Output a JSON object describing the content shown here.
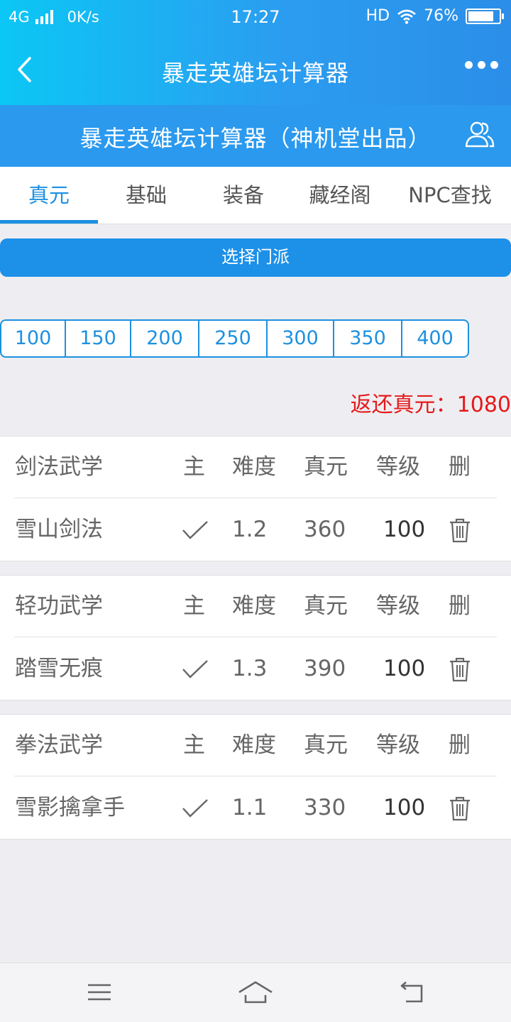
{
  "status_bar": {
    "network": "4G",
    "speed": "0K/s",
    "time": "17:27",
    "hd": "HD",
    "battery": "76%",
    "battery_level": 0.76
  },
  "navbar": {
    "title": "暴走英雄坛计算器"
  },
  "subheader": {
    "title": "暴走英雄坛计算器（神机堂出品）"
  },
  "tabs": [
    "真元",
    "基础",
    "装备",
    "藏经阁",
    "NPC查找"
  ],
  "active_tab": 0,
  "select_sect": "选择门派",
  "levels": [
    "100",
    "150",
    "200",
    "250",
    "300",
    "350",
    "400"
  ],
  "refund": {
    "label": "返还真元：",
    "value": "1080"
  },
  "sections": [
    {
      "header": {
        "category": "剑法武学",
        "main": "主",
        "difficulty": "难度",
        "zhenyuan": "真元",
        "level": "等级",
        "delete": "删"
      },
      "item": {
        "name": "雪山剑法",
        "difficulty": "1.2",
        "zhenyuan": "360",
        "level": "100",
        "is_main": true
      }
    },
    {
      "header": {
        "category": "轻功武学",
        "main": "主",
        "difficulty": "难度",
        "zhenyuan": "真元",
        "level": "等级",
        "delete": "删"
      },
      "item": {
        "name": "踏雪无痕",
        "difficulty": "1.3",
        "zhenyuan": "390",
        "level": "100",
        "is_main": true
      }
    },
    {
      "header": {
        "category": "拳法武学",
        "main": "主",
        "difficulty": "难度",
        "zhenyuan": "真元",
        "level": "等级",
        "delete": "删"
      },
      "item": {
        "name": "雪影擒拿手",
        "difficulty": "1.1",
        "zhenyuan": "330",
        "level": "100",
        "is_main": true
      }
    }
  ],
  "colors": {
    "accent": "#1d90e0",
    "refund": "#e5191a",
    "header_blue": "#2a99ee"
  },
  "icons": {
    "back": "chevron-left-icon",
    "more": "more-dots-icon",
    "user": "users-icon",
    "check": "check-icon",
    "delete": "trash-icon",
    "menu": "menu-icon",
    "home": "home-icon",
    "back_nav": "back-arrow-icon"
  }
}
